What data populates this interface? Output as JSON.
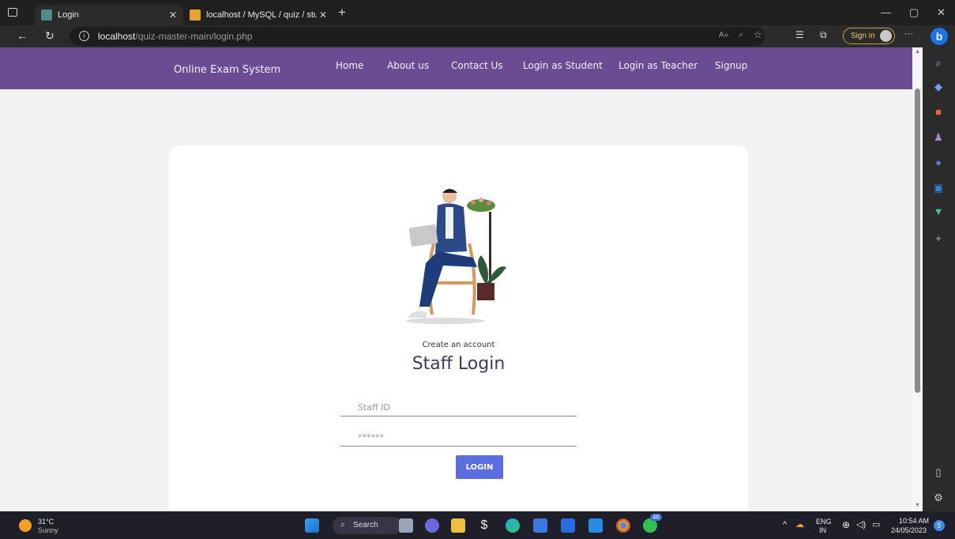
{
  "browser": {
    "tabs": [
      {
        "label": "Login",
        "active": true
      },
      {
        "label": "localhost / MySQL / quiz / studer",
        "active": false
      }
    ],
    "new_tab": "+",
    "url_host": "localhost",
    "url_path": "/quiz-master-main/login.php",
    "signin_label": "Sign in",
    "more": "···"
  },
  "site": {
    "brand": "Online Exam System",
    "nav": [
      "Home",
      "About us",
      "Contact Us",
      "Login as Student",
      "Login as Teacher",
      "Signup"
    ],
    "accent": "#6a4c93"
  },
  "login": {
    "subtitle": "Create an account",
    "title": "Staff Login",
    "id_placeholder": "Staff ID",
    "password_placeholder": "******",
    "button": "LOGIN",
    "button_color": "#5b6ee1"
  },
  "taskbar": {
    "temp": "31°C",
    "weather": "Sunny",
    "search": "Search",
    "lang1": "ENG",
    "lang2": "IN",
    "time": "10:54 AM",
    "date": "24/05/2023",
    "badge": "46",
    "notif": "5"
  }
}
